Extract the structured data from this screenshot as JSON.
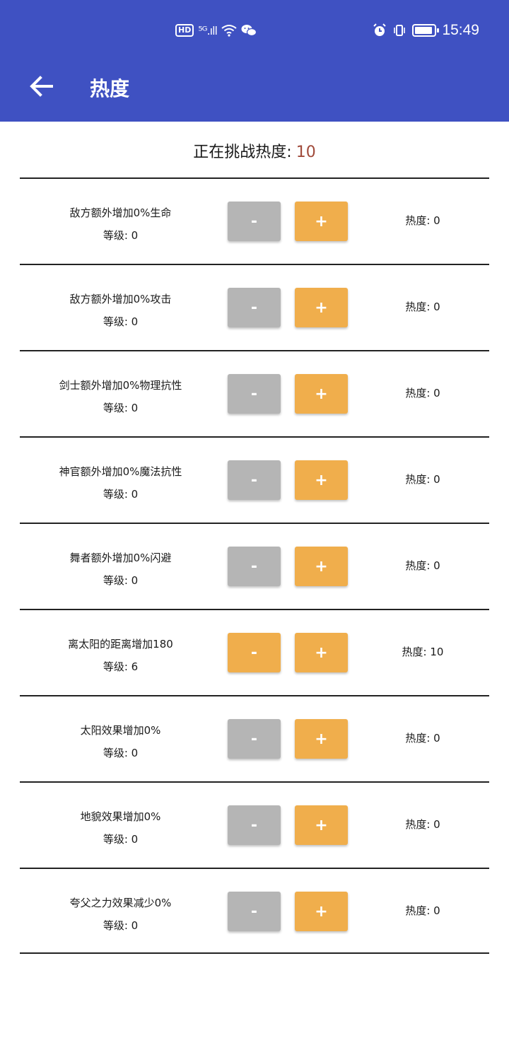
{
  "status_bar": {
    "left_icons": [
      "hd-icon",
      "5g-signal-icon",
      "wifi-icon",
      "wechat-icon"
    ],
    "hd_label": "HD",
    "signal_label": "⁵ᴳ.ıll",
    "time": "15:49"
  },
  "header": {
    "title": "热度"
  },
  "challenge": {
    "label": "正在挑战热度:",
    "value": "10"
  },
  "colors": {
    "primary": "#3f51c2",
    "accent": "#f0ae4c",
    "disabled": "#b5b5b5",
    "value": "#a04a3a"
  },
  "rows": [
    {
      "name": "敌方额外增加0%生命",
      "level": "等级: 0",
      "minus": "-",
      "plus": "+",
      "heat": "热度: 0",
      "minus_active": false
    },
    {
      "name": "敌方额外增加0%攻击",
      "level": "等级: 0",
      "minus": "-",
      "plus": "+",
      "heat": "热度: 0",
      "minus_active": false
    },
    {
      "name": "剑士额外增加0%物理抗性",
      "level": "等级: 0",
      "minus": "-",
      "plus": "+",
      "heat": "热度: 0",
      "minus_active": false
    },
    {
      "name": "神官额外增加0%魔法抗性",
      "level": "等级: 0",
      "minus": "-",
      "plus": "+",
      "heat": "热度: 0",
      "minus_active": false
    },
    {
      "name": "舞者额外增加0%闪避",
      "level": "等级: 0",
      "minus": "-",
      "plus": "+",
      "heat": "热度: 0",
      "minus_active": false
    },
    {
      "name": "离太阳的距离增加180",
      "level": "等级: 6",
      "minus": "-",
      "plus": "+",
      "heat": "热度: 10",
      "minus_active": true
    },
    {
      "name": "太阳效果增加0%",
      "level": "等级: 0",
      "minus": "-",
      "plus": "+",
      "heat": "热度: 0",
      "minus_active": false
    },
    {
      "name": "地貌效果增加0%",
      "level": "等级: 0",
      "minus": "-",
      "plus": "+",
      "heat": "热度: 0",
      "minus_active": false
    },
    {
      "name": "夸父之力效果减少0%",
      "level": "等级: 0",
      "minus": "-",
      "plus": "+",
      "heat": "热度: 0",
      "minus_active": false
    }
  ]
}
